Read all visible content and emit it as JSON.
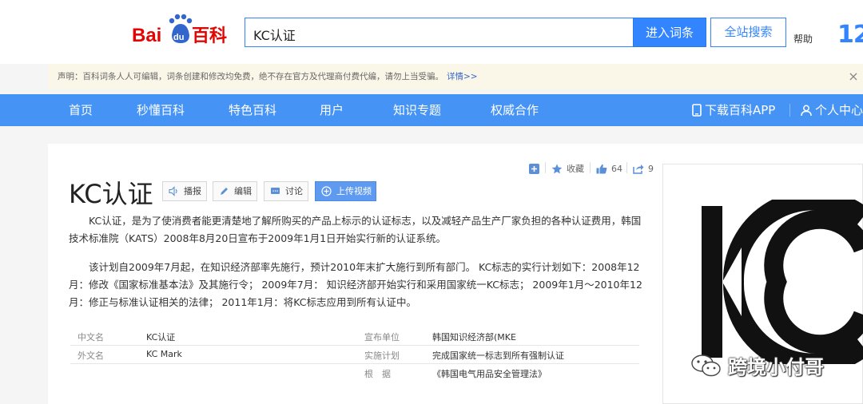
{
  "header": {
    "logo_alt": "Baidu百科",
    "search_value": "KC认证",
    "enter_button": "进入词条",
    "site_search_button": "全站搜索",
    "help": "帮助",
    "big_number": "12"
  },
  "notice": {
    "text": "声明：百科词条人人可编辑，词条创建和修改均免费，绝不存在官方及代理商付费代编，请勿上当受骗。",
    "more": "详情>>",
    "close": "×"
  },
  "nav": {
    "items": [
      "首页",
      "秒懂百科",
      "特色百科",
      "用户",
      "知识专题",
      "权威合作"
    ],
    "download_app": "下载百科APP",
    "personal": "个人中心"
  },
  "entry": {
    "title": "KC认证",
    "tools": {
      "broadcast": "播报",
      "edit": "编辑",
      "discuss": "讨论",
      "upload_video": "上传视频"
    },
    "actions": {
      "collect": "收藏",
      "like_count": "64",
      "share_count": "9"
    },
    "paragraphs": [
      "KC认证，是为了使消费者能更清楚地了解所购买的产品上标示的认证标志，以及减轻产品生产厂家负担的各种认证费用，韩国技术标准院（KATS）2008年8月20日宣布于2009年1月1日开始实行新的认证系统。",
      "该计划自2009年7月起，在知识经济部率先施行，预计2010年末扩大施行到所有部门。 KC标志的实行计划如下：2008年12月：修改《国家标准基本法》及其施行令； 2009年7月： 知识经济部开始实行和采用国家统一KC标志； 2009年1月～2010年12月：修正与标准认证相关的法律； 2011年1月：将KC标志应用到所有认证中。"
    ],
    "info_left": [
      {
        "label": "中文名",
        "value": "KC认证"
      },
      {
        "label": "外文名",
        "value": "KC Mark"
      }
    ],
    "info_right": [
      {
        "label": "宣布单位",
        "value": "韩国知识经济部(MKE"
      },
      {
        "label": "实施计划",
        "value": "完成国家统一标志到所有强制认证"
      },
      {
        "label": "根　据",
        "value": "《韩国电气用品安全管理法》"
      }
    ]
  },
  "watermark": {
    "text": "跨境小付哥"
  },
  "colors": {
    "brand_blue": "#3385ff",
    "nav_blue": "#4593f4",
    "baidu_red": "#e10602"
  }
}
